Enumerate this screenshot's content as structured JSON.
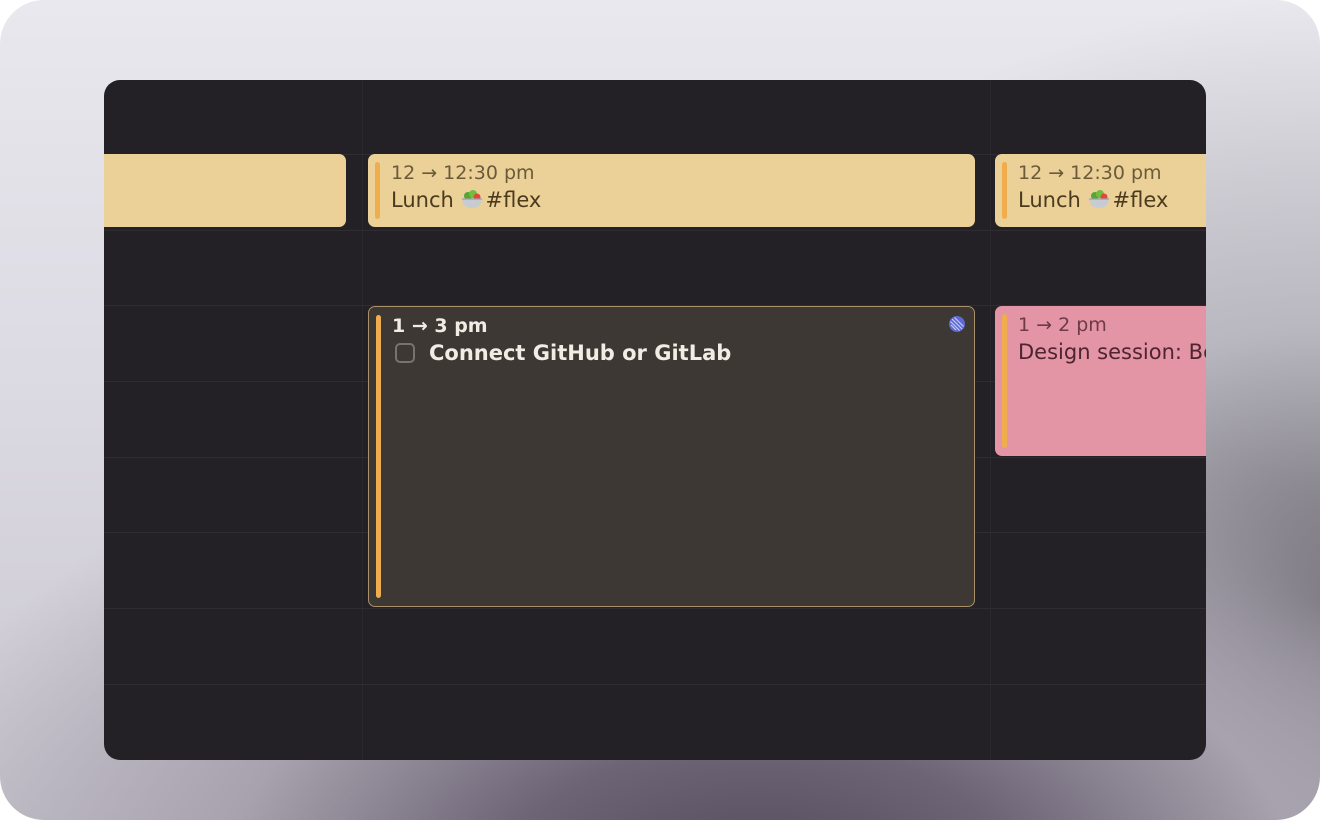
{
  "events": {
    "lunch_day2": {
      "time": "12 → 12:30 pm",
      "title_text": "Lunch",
      "tag": "#flex",
      "icon": "salad-bowl-icon"
    },
    "lunch_day3": {
      "time": "12 → 12:30 pm",
      "title_text": "Lunch",
      "tag": "#flex",
      "icon": "salad-bowl-icon"
    },
    "task": {
      "time": "1 → 3 pm",
      "title": "Connect GitHub or GitLab",
      "sync_icon": "linear-icon",
      "completed": false
    },
    "design": {
      "time": "1 → 2 pm",
      "title": "Design session: Be"
    }
  },
  "colors": {
    "calendar_bg": "#232125",
    "lunch_bg": "#ebd198",
    "accent_bar": "#f0ad4e",
    "task_bg": "#3d3834",
    "design_bg": "#e395a6",
    "linear_icon": "#5e6ad2"
  }
}
